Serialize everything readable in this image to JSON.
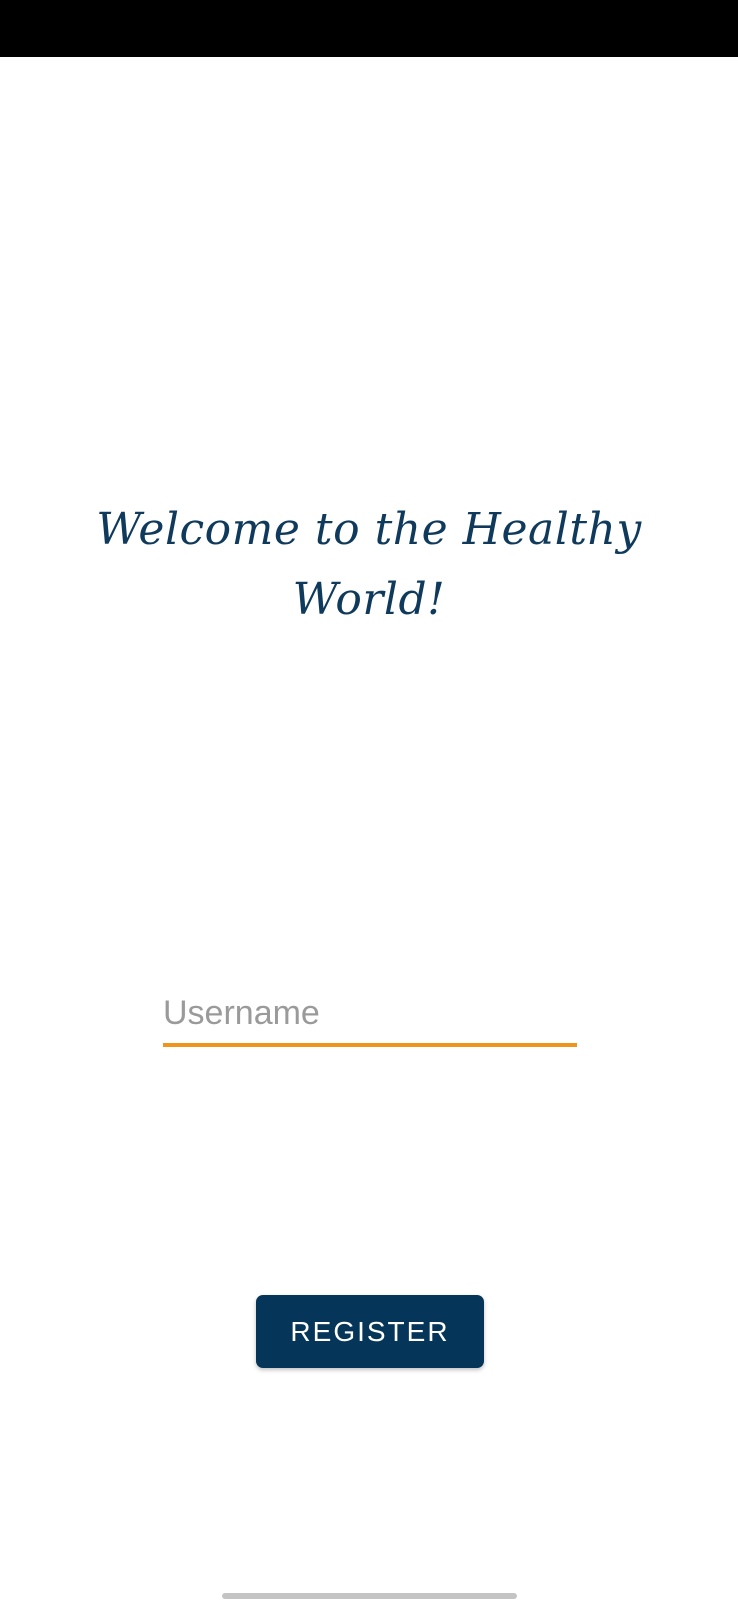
{
  "welcome": {
    "title": "Welcome to the Healthy World!"
  },
  "form": {
    "username": {
      "value": "",
      "placeholder": "Username"
    },
    "register_label": "REGISTER"
  },
  "colors": {
    "title": "#0f3a5c",
    "accent_underline": "#f0951b",
    "button_background": "#05365a",
    "button_text": "#ffffff",
    "placeholder": "#9a9a9a",
    "status_bar": "#000000"
  }
}
